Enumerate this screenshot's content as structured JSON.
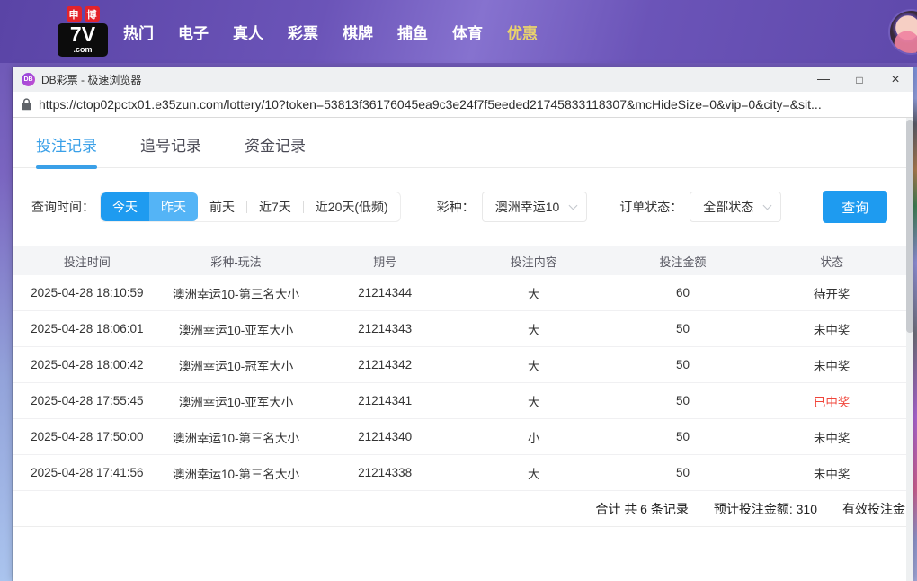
{
  "site_nav": {
    "logo": {
      "badge1": "申",
      "badge2": "博",
      "main": "7V",
      "suffix": ".com"
    },
    "items": [
      {
        "label": "热门",
        "highlighted": false
      },
      {
        "label": "电子",
        "highlighted": false
      },
      {
        "label": "真人",
        "highlighted": false
      },
      {
        "label": "彩票",
        "highlighted": false
      },
      {
        "label": "棋牌",
        "highlighted": false
      },
      {
        "label": "捕鱼",
        "highlighted": false
      },
      {
        "label": "体育",
        "highlighted": false
      },
      {
        "label": "优惠",
        "highlighted": true
      }
    ]
  },
  "browser": {
    "app_icon_text": "DB",
    "title": "DB彩票 - 极速浏览器",
    "url": "https://ctop02pctx01.e35zun.com/lottery/10?token=53813f36176045ea9c3e24f7f5eeded21745833118307&mcHideSize=0&vip=0&city=&sit..."
  },
  "icons": {
    "minimize": "—",
    "maximize": "□",
    "close": "×"
  },
  "tabs": [
    {
      "label": "投注记录",
      "active": true
    },
    {
      "label": "追号记录",
      "active": false
    },
    {
      "label": "资金记录",
      "active": false
    }
  ],
  "filters": {
    "time_label": "查询时间：",
    "time_options": [
      {
        "label": "今天",
        "style": "primary"
      },
      {
        "label": "昨天",
        "style": "secondary"
      },
      {
        "label": "前天",
        "style": "plain"
      },
      {
        "label": "近7天",
        "style": "plain"
      },
      {
        "label": "近20天(低频)",
        "style": "plain"
      }
    ],
    "lottery_label": "彩种：",
    "lottery_value": "澳洲幸运10",
    "status_label": "订单状态：",
    "status_value": "全部状态",
    "search_button": "查询"
  },
  "table": {
    "headers": [
      "投注时间",
      "彩种-玩法",
      "期号",
      "投注内容",
      "投注金额",
      "状态"
    ],
    "rows": [
      {
        "time": "2025-04-28 18:10:59",
        "game": "澳洲幸运10-第三名大小",
        "issue": "21214344",
        "content": "大",
        "amount": "60",
        "status": "待开奖",
        "win": false
      },
      {
        "time": "2025-04-28 18:06:01",
        "game": "澳洲幸运10-亚军大小",
        "issue": "21214343",
        "content": "大",
        "amount": "50",
        "status": "未中奖",
        "win": false
      },
      {
        "time": "2025-04-28 18:00:42",
        "game": "澳洲幸运10-冠军大小",
        "issue": "21214342",
        "content": "大",
        "amount": "50",
        "status": "未中奖",
        "win": false
      },
      {
        "time": "2025-04-28 17:55:45",
        "game": "澳洲幸运10-亚军大小",
        "issue": "21214341",
        "content": "大",
        "amount": "50",
        "status": "已中奖",
        "win": true
      },
      {
        "time": "2025-04-28 17:50:00",
        "game": "澳洲幸运10-第三名大小",
        "issue": "21214340",
        "content": "小",
        "amount": "50",
        "status": "未中奖",
        "win": false
      },
      {
        "time": "2025-04-28 17:41:56",
        "game": "澳洲幸运10-第三名大小",
        "issue": "21214338",
        "content": "大",
        "amount": "50",
        "status": "未中奖",
        "win": false
      }
    ]
  },
  "summary": {
    "total": "合计 共 6 条记录",
    "expected": "预计投注金额: 310",
    "valid_partial": "有效投注金"
  },
  "colors": {
    "accent_blue": "#1e9bf0",
    "secondary_blue": "#54b4f6",
    "tab_active_blue": "#3aa0e8",
    "win_red": "#f0453a",
    "nav_highlight_yellow": "#e9d26d",
    "navbar_purple": "#6b54b8"
  }
}
